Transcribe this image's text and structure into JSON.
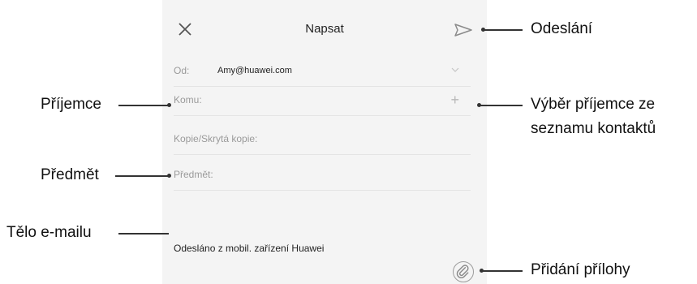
{
  "compose": {
    "title": "Napsat",
    "from_label": "Od:",
    "from_value": "Amy@huawei.com",
    "to_label": "Komu:",
    "cc_bcc_label": "Kopie/Skrytá kopie:",
    "subject_label": "Předmět:",
    "signature": "Odesláno z mobil. zařízení Huawei",
    "add_recipient_symbol": "+"
  },
  "callouts": {
    "send": "Odeslání",
    "recipient": "Příjemce",
    "pick_contact_line1": "Výběr příjemce ze",
    "pick_contact_line2": "seznamu kontaktů",
    "subject": "Předmět",
    "body": "Tělo e-mailu",
    "attachment": "Přidání přílohy"
  },
  "icons": {
    "close": "close-icon",
    "send": "send-icon",
    "chevron": "chevron-down-icon",
    "plus": "plus-icon",
    "attach": "paperclip-icon"
  }
}
